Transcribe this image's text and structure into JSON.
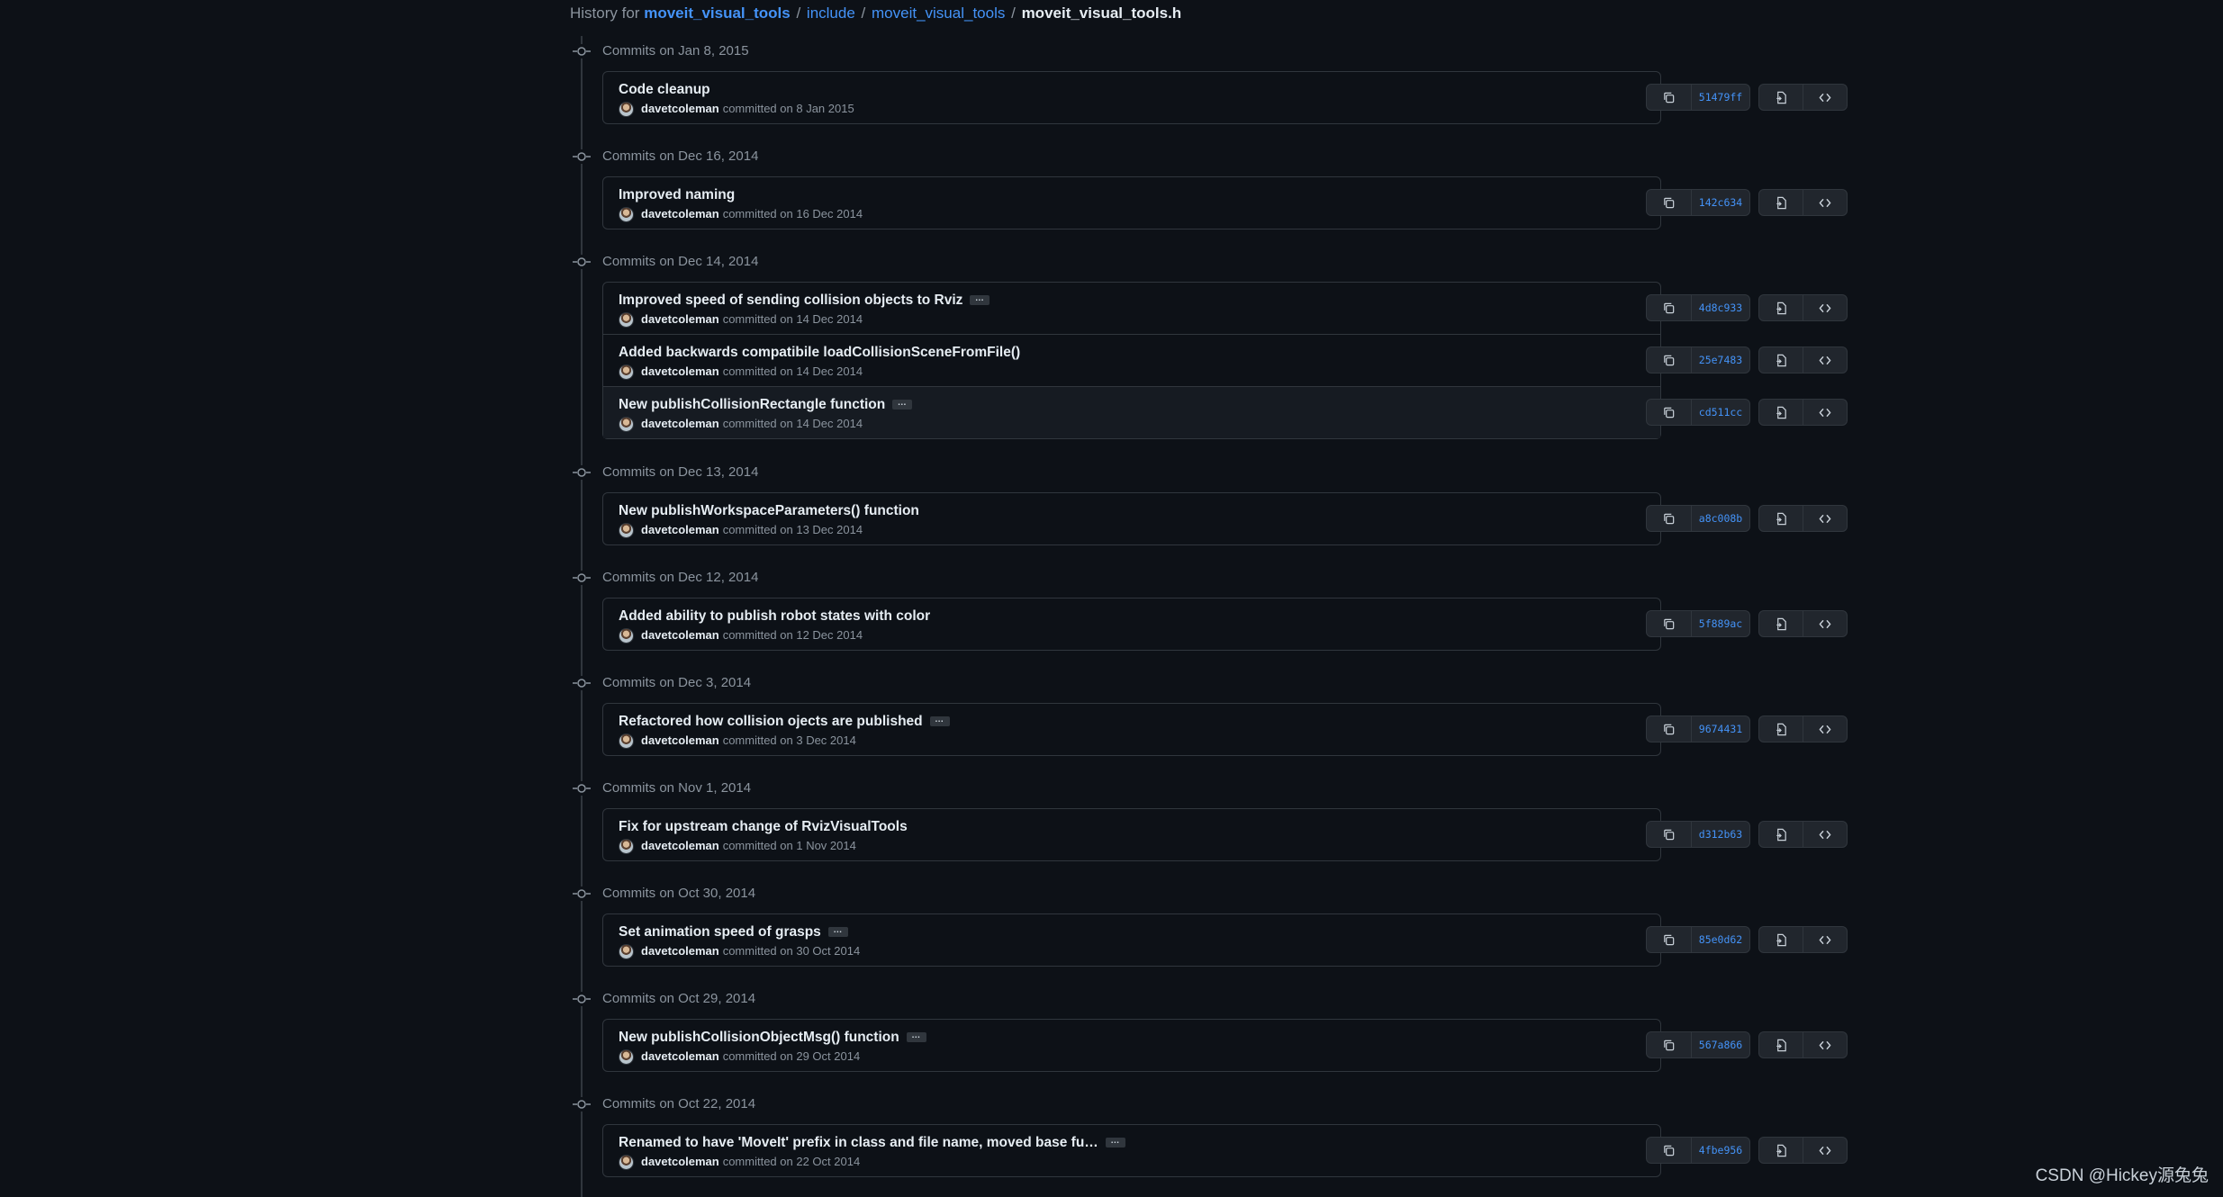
{
  "breadcrumb": {
    "prefix": "History for",
    "repo": "moveit_visual_tools",
    "sep": "/",
    "path1": "include",
    "path2": "moveit_visual_tools",
    "file": "moveit_visual_tools.h"
  },
  "groups": [
    {
      "date": "Commits on Jan 8, 2015",
      "commits": [
        {
          "title": "Code cleanup",
          "ellipsis": false,
          "author": "davetcoleman",
          "committed": "committed on 8 Jan 2015",
          "sha": "51479ff"
        }
      ]
    },
    {
      "date": "Commits on Dec 16, 2014",
      "commits": [
        {
          "title": "Improved naming",
          "ellipsis": false,
          "author": "davetcoleman",
          "committed": "committed on 16 Dec 2014",
          "sha": "142c634"
        }
      ]
    },
    {
      "date": "Commits on Dec 14, 2014",
      "commits": [
        {
          "title": "Improved speed of sending collision objects to Rviz",
          "ellipsis": true,
          "author": "davetcoleman",
          "committed": "committed on 14 Dec 2014",
          "sha": "4d8c933"
        },
        {
          "title": "Added backwards compatibile loadCollisionSceneFromFile()",
          "ellipsis": false,
          "author": "davetcoleman",
          "committed": "committed on 14 Dec 2014",
          "sha": "25e7483"
        },
        {
          "title": "New publishCollisionRectangle function",
          "ellipsis": true,
          "author": "davetcoleman",
          "committed": "committed on 14 Dec 2014",
          "sha": "cd511cc",
          "highlight": true
        }
      ]
    },
    {
      "date": "Commits on Dec 13, 2014",
      "commits": [
        {
          "title": "New publishWorkspaceParameters() function",
          "ellipsis": false,
          "author": "davetcoleman",
          "committed": "committed on 13 Dec 2014",
          "sha": "a8c008b"
        }
      ]
    },
    {
      "date": "Commits on Dec 12, 2014",
      "commits": [
        {
          "title": "Added ability to publish robot states with color",
          "ellipsis": false,
          "author": "davetcoleman",
          "committed": "committed on 12 Dec 2014",
          "sha": "5f889ac"
        }
      ]
    },
    {
      "date": "Commits on Dec 3, 2014",
      "commits": [
        {
          "title": "Refactored how collision ojects are published",
          "ellipsis": true,
          "author": "davetcoleman",
          "committed": "committed on 3 Dec 2014",
          "sha": "9674431"
        }
      ]
    },
    {
      "date": "Commits on Nov 1, 2014",
      "commits": [
        {
          "title": "Fix for upstream change of RvizVisualTools",
          "ellipsis": false,
          "author": "davetcoleman",
          "committed": "committed on 1 Nov 2014",
          "sha": "d312b63"
        }
      ]
    },
    {
      "date": "Commits on Oct 30, 2014",
      "commits": [
        {
          "title": "Set animation speed of grasps",
          "ellipsis": true,
          "author": "davetcoleman",
          "committed": "committed on 30 Oct 2014",
          "sha": "85e0d62"
        }
      ]
    },
    {
      "date": "Commits on Oct 29, 2014",
      "commits": [
        {
          "title": "New publishCollisionObjectMsg() function",
          "ellipsis": true,
          "author": "davetcoleman",
          "committed": "committed on 29 Oct 2014",
          "sha": "567a866"
        }
      ]
    },
    {
      "date": "Commits on Oct 22, 2014",
      "commits": [
        {
          "title": "Renamed to have 'MoveIt' prefix in class and file name, moved base fu…",
          "ellipsis": true,
          "author": "davetcoleman",
          "committed": "committed on 22 Oct 2014",
          "sha": "4fbe956"
        }
      ]
    }
  ],
  "watermark": "CSDN @Hickey源兔兔",
  "colors": {
    "background": "#0d1117",
    "link": "#4493f8",
    "border": "#30363d",
    "muted": "#8b949e"
  }
}
